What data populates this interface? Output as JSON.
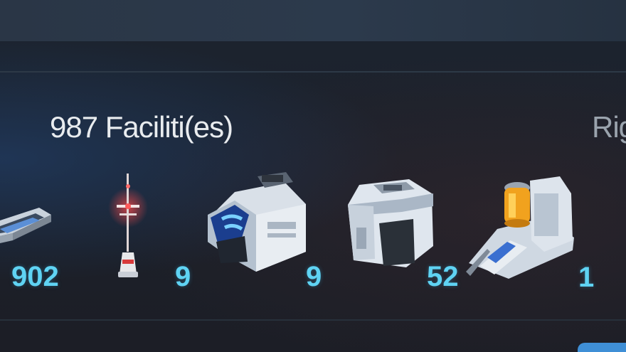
{
  "facilities_panel": {
    "title": "987 Faciliti(es)",
    "right_label": "Rig",
    "items": [
      {
        "icon": "conveyor-icon",
        "count": "902"
      },
      {
        "icon": "antenna-tower-icon",
        "count": "9"
      },
      {
        "icon": "blue-module-icon",
        "count": "9"
      },
      {
        "icon": "bunker-icon",
        "count": "52"
      },
      {
        "icon": "reactor-building-icon",
        "count": "1"
      }
    ]
  },
  "colors": {
    "count_text": "#5fd3f3",
    "title_text": "#e9ecef",
    "background": "#1b212b"
  }
}
